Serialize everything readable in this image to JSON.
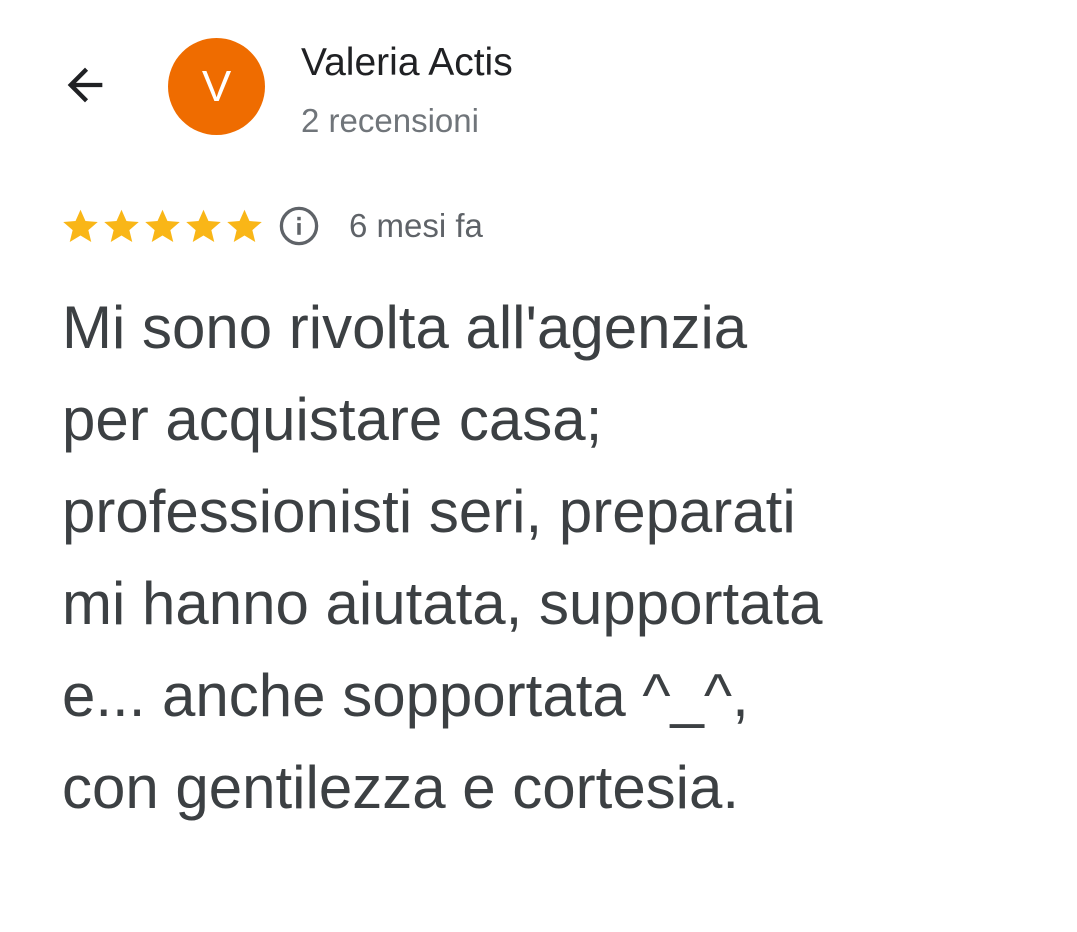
{
  "reviewer": {
    "name": "Valeria Actis",
    "avatar_initial": "V",
    "avatar_color": "#ef6c00",
    "reviews_count": "2 recensioni"
  },
  "header": {
    "back_icon": "arrow-back-icon"
  },
  "review": {
    "rating": 5,
    "rating_max": 5,
    "star_color": "#f9b617",
    "info_icon": "info-icon",
    "date": "6 mesi fa",
    "text": "Mi sono rivolta all'agenzia\nper acquistare casa;\nprofessionisti seri, preparati\nmi hanno aiutata, supportata\ne... anche sopportata ^_^,\ncon gentilezza e cortesia."
  }
}
